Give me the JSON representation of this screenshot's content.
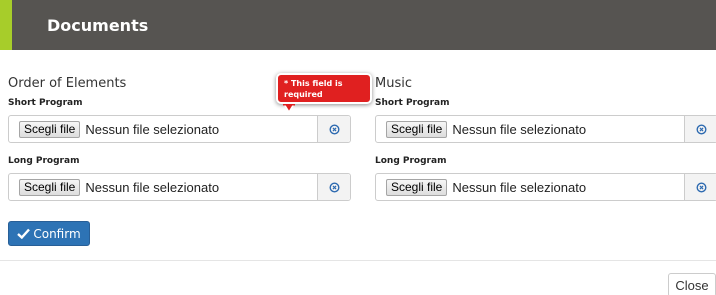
{
  "header": {
    "title": "Documents",
    "accent_color": "#a7cd2a",
    "background_color": "#565451"
  },
  "order_of_elements": {
    "title": "Order of Elements",
    "short_program": {
      "label": "Short Program",
      "button": "Scegli file",
      "status": "Nessun file selezionato",
      "clear_icon": "circle-x-icon"
    },
    "long_program": {
      "label": "Long Program",
      "button": "Scegli file",
      "status": "Nessun file selezionato",
      "clear_icon": "circle-x-icon"
    }
  },
  "music": {
    "title": "Music",
    "short_program": {
      "label": "Short Program",
      "button": "Scegli file",
      "status": "Nessun file selezionato",
      "clear_icon": "circle-x-icon"
    },
    "long_program": {
      "label": "Long Program",
      "button": "Scegli file",
      "status": "Nessun file selezionato",
      "clear_icon": "circle-x-icon"
    }
  },
  "validation": {
    "message": "* This field is required",
    "color": "#e02020"
  },
  "actions": {
    "confirm": "Confirm",
    "confirm_icon": "checkmark-icon",
    "confirm_color": "#2d73b5",
    "close": "Close"
  }
}
